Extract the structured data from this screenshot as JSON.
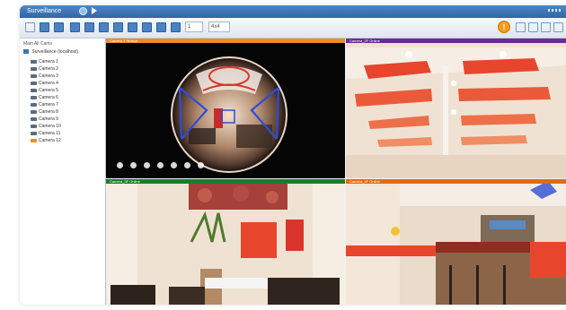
{
  "window": {
    "title": "Surveillance"
  },
  "toolbar": {
    "input_value": "1",
    "zoom_value": "4x4"
  },
  "colors": {
    "titlebar": "#3a75b5",
    "accent_orange": "#f39a1d",
    "cam1_header": "#f08a24",
    "cam2_header": "#6a2a91",
    "cam3_header": "#1b7a2e",
    "cam4_header": "#e66a0e"
  },
  "sidebar": {
    "header": "Main  All Cams",
    "root_label": "Surveillance (localhost)",
    "cameras": [
      "Camera 1",
      "Camera 2",
      "Camera 3",
      "Camera 4",
      "Camera 5",
      "Camera 6",
      "Camera 7",
      "Camera 8",
      "Camera 9",
      "Camera 10",
      "Camera 11",
      "Camera 12"
    ]
  },
  "views": {
    "cam1": {
      "label": "Camera 1  fisheye"
    },
    "cam2": {
      "label": "Camera_2F    Online"
    },
    "cam3": {
      "label": "Camera_3F    Online"
    },
    "cam4": {
      "label": "Camera_4F    Online"
    }
  }
}
